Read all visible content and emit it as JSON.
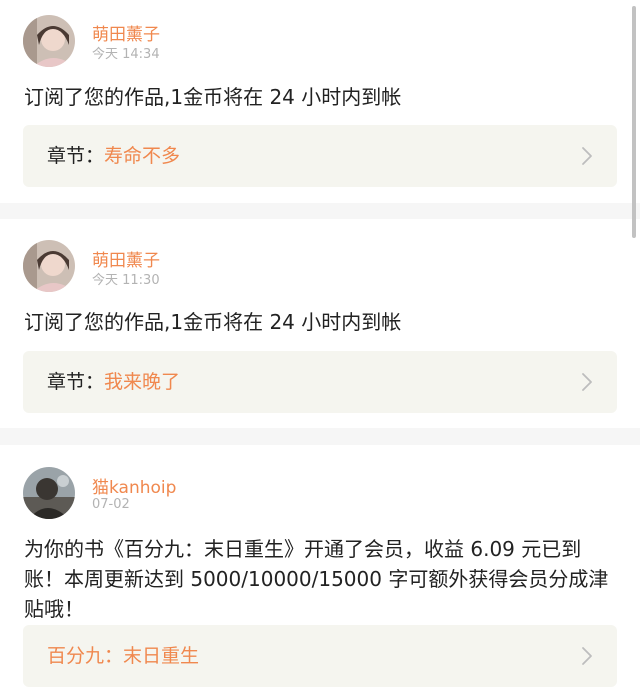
{
  "notifications": [
    {
      "user": "萌田薰子",
      "time": "今天 14:34",
      "message": "订阅了您的作品,1金币将在 24 小时内到帐",
      "chapter_prefix": "章节：",
      "chapter_title": "寿命不多"
    },
    {
      "user": "萌田薰子",
      "time": "今天 11:30",
      "message": "订阅了您的作品,1金币将在 24 小时内到帐",
      "chapter_prefix": "章节：",
      "chapter_title": "我来晚了"
    },
    {
      "user": "猫kanhoip",
      "time": "07-02",
      "message": "为你的书《百分九：末日重生》开通了会员，收益 6.09 元已到账！本周更新达到 5000/10000/15000 字可额外获得会员分成津贴哦！",
      "chapter_prefix": "",
      "chapter_title": "百分九：末日重生"
    }
  ],
  "icons": {
    "chevron": "chevron-right-icon",
    "avatar": "user-avatar"
  },
  "colors": {
    "accent": "#f0884e",
    "timestamp": "#b3b3b3",
    "text": "#222222",
    "chapter_bg": "#f5f5ef",
    "divider": "#f6f6f6"
  }
}
